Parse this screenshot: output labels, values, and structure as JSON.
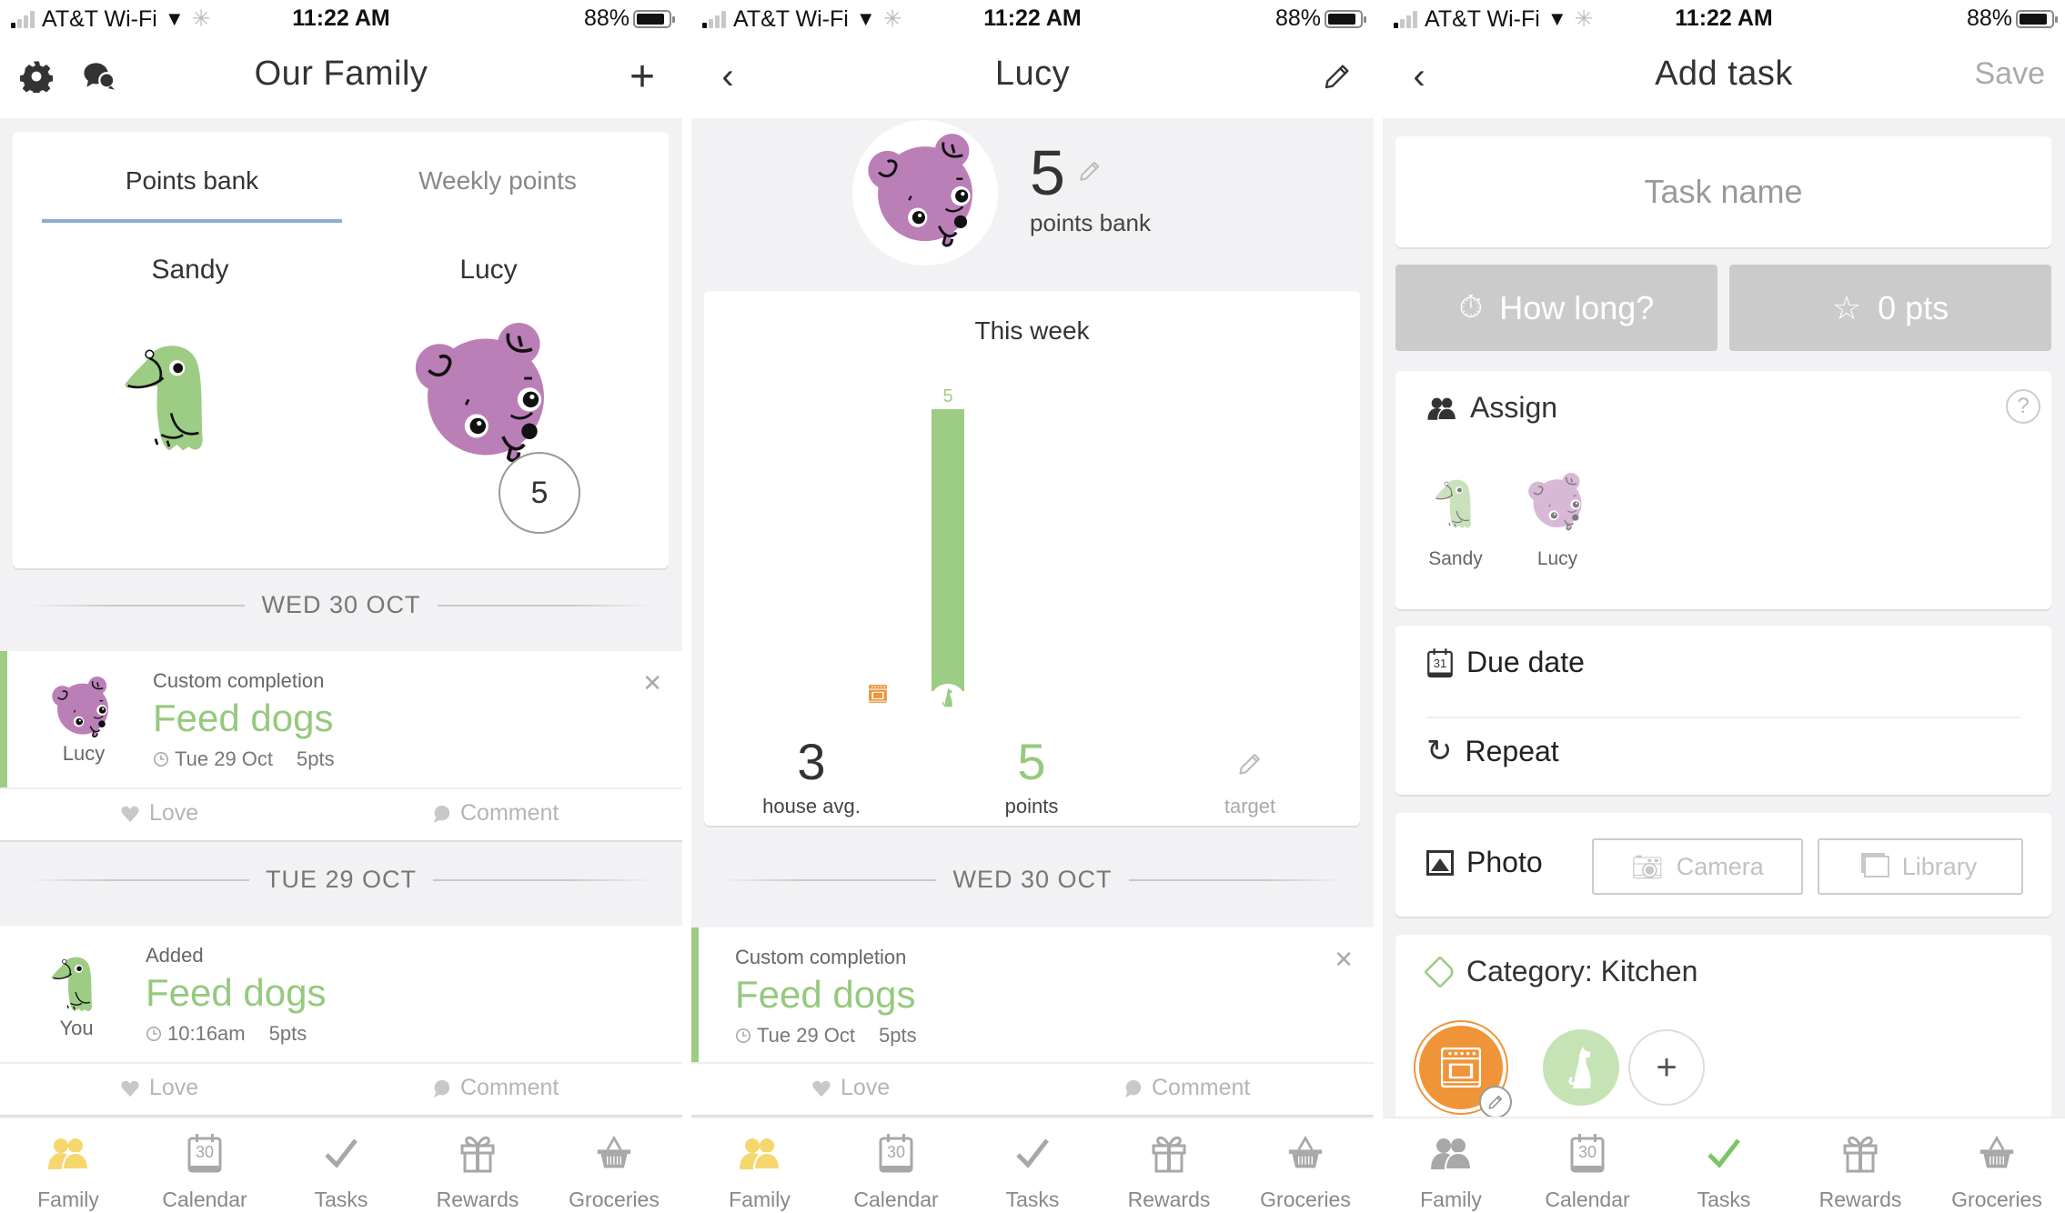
{
  "status_bar": {
    "carrier": "AT&T Wi-Fi",
    "time": "11:22 AM",
    "battery": "88%",
    "battery_level": 0.88
  },
  "screens": {
    "family": {
      "title": "Our Family",
      "points_card": {
        "tabs": [
          {
            "label": "Points bank",
            "active": true
          },
          {
            "label": "Weekly points",
            "active": false
          }
        ],
        "members": [
          {
            "name": "Sandy",
            "avatar": "green-bird"
          },
          {
            "name": "Lucy",
            "avatar": "purple-dog",
            "points": "5"
          }
        ]
      },
      "feed": [
        {
          "date": "WED 30 OCT",
          "type": "Custom completion",
          "who": "Lucy",
          "avatar": "purple-dog",
          "title": "Feed dogs",
          "time": "Tue 29 Oct",
          "points": "5pts",
          "love": "Love",
          "comment": "Comment"
        },
        {
          "date": "TUE 29 OCT",
          "type": "Added",
          "who": "You",
          "avatar": "green-bird",
          "title": "Feed dogs",
          "time": "10:16am",
          "points": "5pts",
          "love": "Love",
          "comment": "Comment"
        }
      ]
    },
    "member": {
      "title": "Lucy",
      "points_bank": "5",
      "points_bank_label": "points bank",
      "this_week": {
        "title": "This week",
        "house_avg": "3",
        "house_avg_label": "house avg.",
        "points": "5",
        "points_label": "points",
        "target_label": "target"
      },
      "feed": [
        {
          "date": "WED 30 OCT",
          "type": "Custom completion",
          "title": "Feed dogs",
          "time": "Tue 29 Oct",
          "points": "5pts",
          "love": "Love",
          "comment": "Comment"
        }
      ]
    },
    "add_task": {
      "title": "Add task",
      "save": "Save",
      "task_name_placeholder": "Task name",
      "task_name_value": "",
      "how_long": "How long?",
      "points": "0 pts",
      "assign": {
        "label": "Assign",
        "help": "?",
        "members": [
          "Sandy",
          "Lucy"
        ]
      },
      "due_date": "Due date",
      "calendar_day": "31",
      "repeat": "Repeat",
      "photo": {
        "label": "Photo",
        "camera": "Camera",
        "library": "Library"
      },
      "category": {
        "label": "Category: Kitchen",
        "options": [
          {
            "name": "kitchen",
            "selected": true,
            "color": "#f0943a"
          },
          {
            "name": "pets",
            "selected": false,
            "color": "#c5e3b4"
          }
        ]
      }
    }
  },
  "chart_data": {
    "type": "bar",
    "title": "This week",
    "categories": [
      "Kitchen",
      "Pets"
    ],
    "values": [
      0,
      5
    ],
    "data_labels": [
      "",
      "5"
    ],
    "ylim": [
      0,
      5
    ],
    "xlabel": "",
    "ylabel": "",
    "colors": [
      "#f0943a",
      "#9dcc84"
    ],
    "house_avg": 3,
    "points": 5,
    "grid": false
  },
  "tabbar": [
    {
      "label": "Family",
      "icon": "family-icon"
    },
    {
      "label": "Calendar",
      "icon": "calendar-icon",
      "day": "30"
    },
    {
      "label": "Tasks",
      "icon": "check-icon"
    },
    {
      "label": "Rewards",
      "icon": "gift-icon"
    },
    {
      "label": "Groceries",
      "icon": "basket-icon"
    }
  ],
  "active_tab": {
    "family": 0,
    "member": 0,
    "add_task": 2
  },
  "colors": {
    "accent_green": "#96c97d",
    "tab_active_family": "#f5d76e",
    "tab_active_tasks": "#7cc46a",
    "tab_inactive": "#a8a8a8",
    "tab_underline": "#8eaad6"
  }
}
